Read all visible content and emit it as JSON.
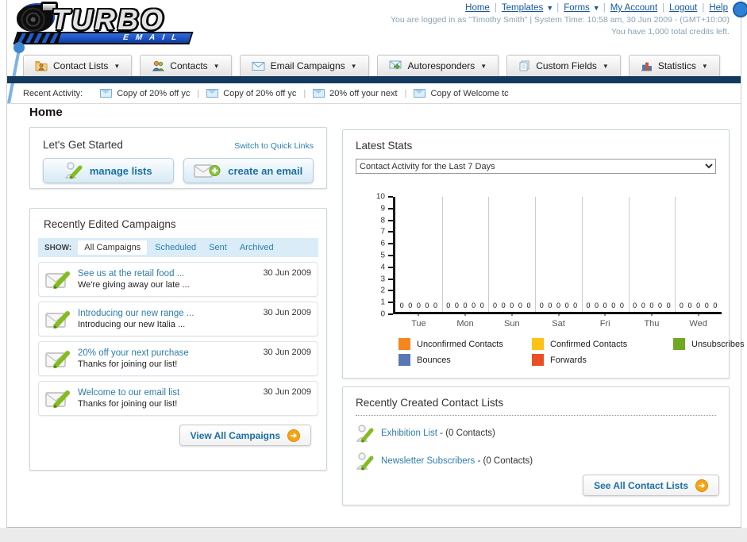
{
  "header": {
    "logo_title": "TURBO",
    "logo_subtitle": "EMAIL",
    "links": [
      {
        "label": "Home",
        "dropdown": false
      },
      {
        "label": "Templates",
        "dropdown": true
      },
      {
        "label": "Forms",
        "dropdown": true
      },
      {
        "label": "My Account",
        "dropdown": false
      },
      {
        "label": "Logout",
        "dropdown": false
      },
      {
        "label": "Help",
        "dropdown": false
      }
    ],
    "link_separator": "|",
    "dropdown_arrow": "▼",
    "login_info": "You are logged in as \"Timothy Smith\" | System Time: 10:58 am, 30 Jun 2009 - (GMT+10:00)",
    "credits_info": "You have 1,000 total credits left."
  },
  "nav": {
    "tabs": [
      {
        "label": "Contact Lists",
        "icon": "folder-user-icon"
      },
      {
        "label": "Contacts",
        "icon": "users-icon"
      },
      {
        "label": "Email Campaigns",
        "icon": "envelope-icon"
      },
      {
        "label": "Autoresponders",
        "icon": "envelope-arrow-icon"
      },
      {
        "label": "Custom Fields",
        "icon": "pages-icon"
      },
      {
        "label": "Statistics",
        "icon": "bar-chart-icon"
      }
    ],
    "dropdown_arrow": "▼"
  },
  "recent_activity": {
    "label": "Recent Activity:",
    "separator": "|",
    "items": [
      "Copy of 20% off yc",
      "Copy of 20% off yc",
      "20% off your next",
      "Copy of Welcome tc"
    ]
  },
  "page_title": "Home",
  "get_started": {
    "title": "Let's Get Started",
    "switch_link": "Switch to Quick Links",
    "manage_lists_label": "manage lists",
    "create_email_label": "create an email"
  },
  "campaigns": {
    "title": "Recently Edited Campaigns",
    "show_label": "SHOW:",
    "filters": [
      "All Campaigns",
      "Scheduled",
      "Sent",
      "Archived"
    ],
    "active_filter": "All Campaigns",
    "items": [
      {
        "title": "See us at the retail food ...",
        "subtitle": "We're giving away our late ...",
        "date": "30 Jun 2009"
      },
      {
        "title": "Introducing our new range ...",
        "subtitle": "Introducing our new Italia ...",
        "date": "30 Jun 2009"
      },
      {
        "title": "20% off your next purchase",
        "subtitle": "Thanks for joining our list!",
        "date": "30 Jun 2009"
      },
      {
        "title": "Welcome to our email list",
        "subtitle": "Thanks for joining our list!",
        "date": "30 Jun 2009"
      }
    ],
    "view_all_label": "View All Campaigns",
    "arrow_icon": "➔"
  },
  "stats": {
    "title": "Latest Stats",
    "selected_option": "Contact Activity for the Last 7 Days"
  },
  "chart_data": {
    "type": "bar",
    "title": "Contact Activity for the Last 7 Days",
    "categories": [
      "Tue",
      "Mon",
      "Sun",
      "Sat",
      "Fri",
      "Thu",
      "Wed"
    ],
    "series": [
      {
        "name": "Unconfirmed Contacts",
        "color": "#f5861f",
        "values": [
          0,
          0,
          0,
          0,
          0,
          0,
          0
        ]
      },
      {
        "name": "Confirmed Contacts",
        "color": "#fdc216",
        "values": [
          0,
          0,
          0,
          0,
          0,
          0,
          0
        ]
      },
      {
        "name": "Unsubscribes",
        "color": "#71a823",
        "values": [
          0,
          0,
          0,
          0,
          0,
          0,
          0
        ]
      },
      {
        "name": "Bounces",
        "color": "#5a77b5",
        "values": [
          0,
          0,
          0,
          0,
          0,
          0,
          0
        ]
      },
      {
        "name": "Forwards",
        "color": "#e94e25",
        "values": [
          0,
          0,
          0,
          0,
          0,
          0,
          0
        ]
      }
    ],
    "ylim": [
      0,
      10
    ],
    "ytick_step": 1,
    "value_labels_shown": true,
    "grid": "vertical-group-separators",
    "legend_position": "bottom"
  },
  "contact_lists": {
    "title": "Recently Created Contact Lists",
    "separator": "-",
    "items": [
      {
        "name": "Exhibition List",
        "count": "(0 Contacts)"
      },
      {
        "name": "Newsletter Subscribers",
        "count": "(0 Contacts)"
      }
    ],
    "see_all_label": "See All Contact Lists",
    "arrow_icon": "➔"
  },
  "colors": {
    "navy_bar": "#14395e",
    "link_blue": "#2d7fb0",
    "button_text_blue": "#1b6fa8",
    "accent_orange": "#f5a414",
    "show_bar_bg": "#d9ecf8"
  }
}
